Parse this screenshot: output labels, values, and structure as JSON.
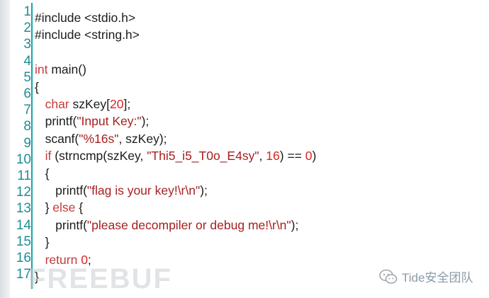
{
  "line_numbers": [
    "1",
    "2",
    "3",
    "4",
    "5",
    "6",
    "7",
    "8",
    "9",
    "10",
    "11",
    "12",
    "13",
    "14",
    "15",
    "16",
    "17"
  ],
  "code_lines": [
    [
      {
        "t": "#include <stdio.h>",
        "c": "plain"
      }
    ],
    [
      {
        "t": "#include <string.h>",
        "c": "plain"
      }
    ],
    [],
    [
      {
        "t": "int",
        "c": "kw"
      },
      {
        "t": " main()",
        "c": "plain"
      }
    ],
    [
      {
        "t": "{",
        "c": "plain"
      }
    ],
    [
      {
        "t": "   ",
        "c": "plain"
      },
      {
        "t": "char",
        "c": "kw"
      },
      {
        "t": " szKey[",
        "c": "plain"
      },
      {
        "t": "20",
        "c": "num"
      },
      {
        "t": "];",
        "c": "plain"
      }
    ],
    [
      {
        "t": "   printf(",
        "c": "plain"
      },
      {
        "t": "\"Input Key:\"",
        "c": "str"
      },
      {
        "t": ");",
        "c": "plain"
      }
    ],
    [
      {
        "t": "   scanf(",
        "c": "plain"
      },
      {
        "t": "\"%16s\"",
        "c": "str"
      },
      {
        "t": ", szKey);",
        "c": "plain"
      }
    ],
    [
      {
        "t": "   ",
        "c": "plain"
      },
      {
        "t": "if",
        "c": "kw"
      },
      {
        "t": " (strncmp(szKey, ",
        "c": "plain"
      },
      {
        "t": "\"Thi5_i5_T0o_E4sy\"",
        "c": "str"
      },
      {
        "t": ", ",
        "c": "plain"
      },
      {
        "t": "16",
        "c": "num"
      },
      {
        "t": ") == ",
        "c": "plain"
      },
      {
        "t": "0",
        "c": "num"
      },
      {
        "t": ")",
        "c": "plain"
      }
    ],
    [
      {
        "t": "   {",
        "c": "plain"
      }
    ],
    [
      {
        "t": "      printf(",
        "c": "plain"
      },
      {
        "t": "\"flag is your key!\\r\\n\"",
        "c": "str"
      },
      {
        "t": ");",
        "c": "plain"
      }
    ],
    [
      {
        "t": "   } ",
        "c": "plain"
      },
      {
        "t": "else",
        "c": "kw"
      },
      {
        "t": " {",
        "c": "plain"
      }
    ],
    [
      {
        "t": "      printf(",
        "c": "plain"
      },
      {
        "t": "\"please decompiler or debug me!\\r\\n\"",
        "c": "str"
      },
      {
        "t": ");",
        "c": "plain"
      }
    ],
    [
      {
        "t": "   }",
        "c": "plain"
      }
    ],
    [
      {
        "t": "   ",
        "c": "plain"
      },
      {
        "t": "return",
        "c": "kw"
      },
      {
        "t": " ",
        "c": "plain"
      },
      {
        "t": "0",
        "c": "num"
      },
      {
        "t": ";",
        "c": "plain"
      }
    ],
    [
      {
        "t": "}",
        "c": "plain"
      }
    ]
  ],
  "watermark": "FREEBUF",
  "brand": {
    "text": "Tide安全团队",
    "icon": "wechat-icon"
  },
  "colors": {
    "gutter_line": "#1aa3a3",
    "line_number": "#1a8f98",
    "keyword": "#c63b3b",
    "string": "#a61f1f",
    "number": "#d92424"
  }
}
